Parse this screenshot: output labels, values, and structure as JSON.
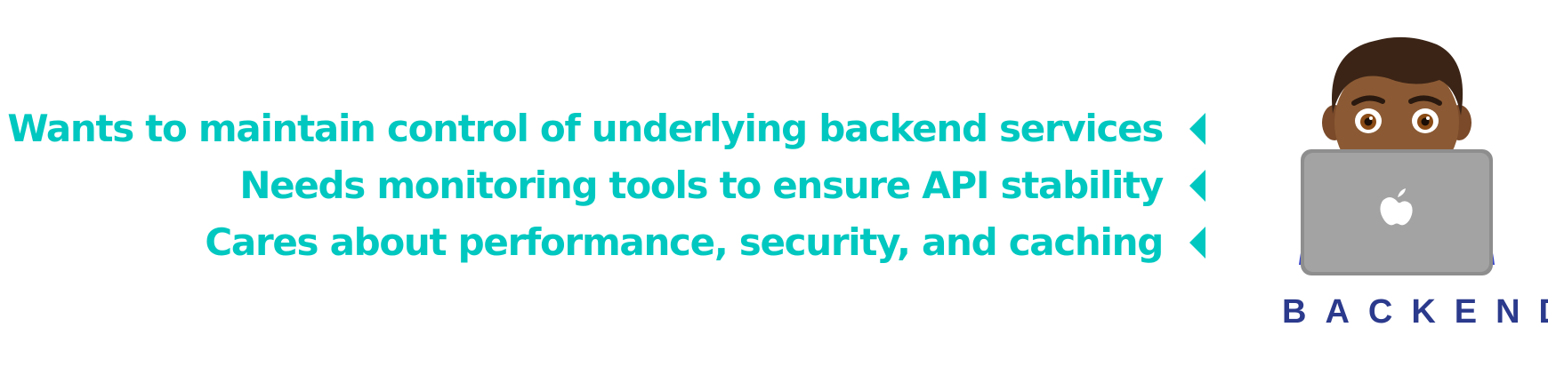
{
  "bullets": [
    {
      "text": "Wants to maintain control of underlying backend services"
    },
    {
      "text": "Needs monitoring tools to ensure API stability"
    },
    {
      "text": "Cares about performance, security, and caching"
    }
  ],
  "persona": {
    "label": "BACKEND",
    "icon": "man-technologist-icon"
  },
  "colors": {
    "accent": "#00c8c0",
    "label": "#2b3a8c"
  }
}
